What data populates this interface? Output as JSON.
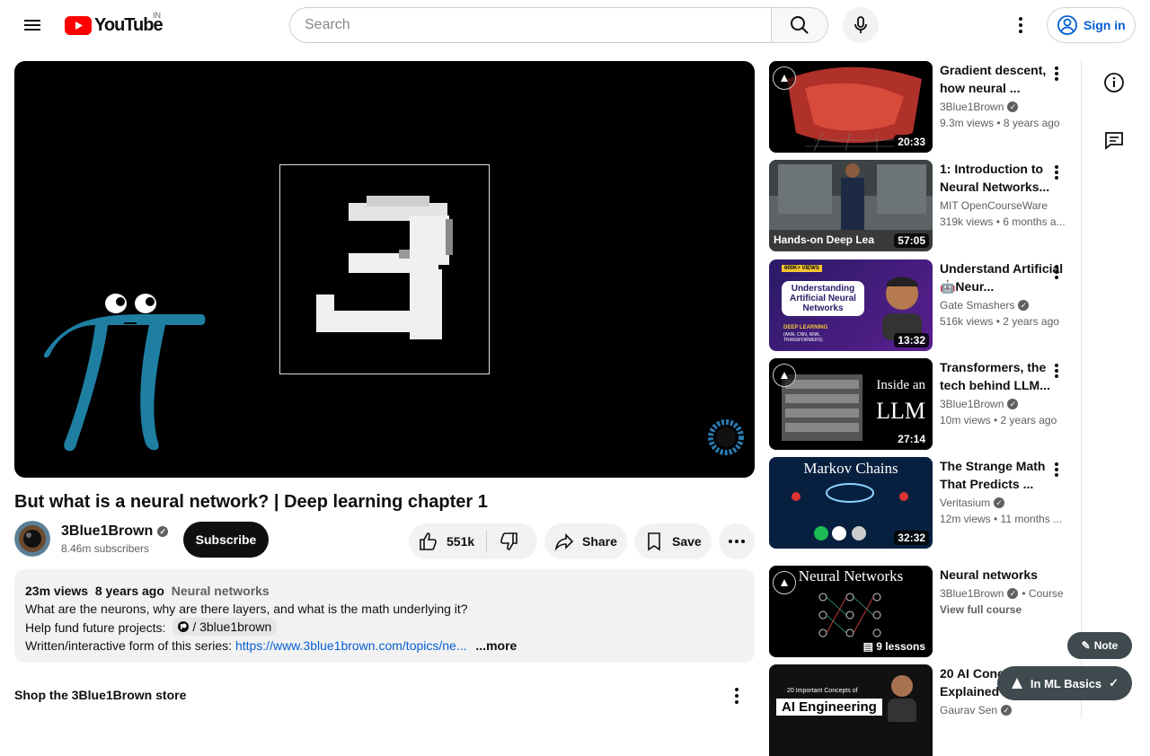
{
  "header": {
    "logo_text": "YouTube",
    "region": "IN",
    "search_placeholder": "Search",
    "signin_label": "Sign in"
  },
  "video": {
    "title": "But what is a neural network? | Deep learning chapter 1",
    "channel_name": "3Blue1Brown",
    "subscribers": "8.46m subscribers",
    "subscribe_label": "Subscribe",
    "likes": "551k",
    "share_label": "Share",
    "save_label": "Save"
  },
  "description": {
    "views": "23m views",
    "age": "8 years ago",
    "tag": "Neural networks",
    "line1": "What are the neurons, why are there layers, and what is the math underlying it?",
    "line2_prefix": "Help fund future projects:",
    "fund_handle": "/ 3blue1brown",
    "line3_prefix": "Written/interactive form of this series:",
    "line3_link": "https://www.3blue1brown.com/topics/ne...",
    "more_label": "...more"
  },
  "store": {
    "title": "Shop the 3Blue1Brown store"
  },
  "recommendations": [
    {
      "title": "Gradient descent, how neural ...",
      "channel": "3Blue1Brown",
      "verified": true,
      "meta": "9.3m views • 8 years ago",
      "duration": "20:33"
    },
    {
      "title": "1: Introduction to Neural Networks...",
      "channel": "MIT OpenCourseWare",
      "verified": false,
      "meta": "319k views • 6 months a...",
      "duration": "57:05",
      "thumb_text": "Hands-on Deep Lea"
    },
    {
      "title": "Understand Artificial 🤖Neur...",
      "channel": "Gate Smashers",
      "verified": true,
      "meta": "516k views • 2 years ago",
      "duration": "13:32",
      "thumb_badge": "600K+ VIEWS",
      "thumb_text": "Understanding Artificial Neural Networks",
      "thumb_sub": "DEEP LEARNING",
      "thumb_sub2": "(ANN, CNN, RNN, TRANSFORMERS)"
    },
    {
      "title": "Transformers, the tech behind LLM...",
      "channel": "3Blue1Brown",
      "verified": true,
      "meta": "10m views • 2 years ago",
      "duration": "27:14",
      "thumb_text": "Inside an",
      "thumb_big": "LLM"
    },
    {
      "title": "The Strange Math That Predicts ...",
      "channel": "Veritasium",
      "verified": true,
      "meta": "12m views • 11 months ...",
      "duration": "32:32",
      "thumb_text": "Markov Chains"
    },
    {
      "title": "Neural networks",
      "channel": "3Blue1Brown",
      "verified": true,
      "channel_suffix": "• Course",
      "meta": "View full course",
      "duration": "9 lessons",
      "thumb_text": "Neural Networks"
    },
    {
      "title": "20 AI Conc... Explained i...",
      "channel": "Gaurav Sen",
      "verified": true,
      "meta": "",
      "duration": "",
      "thumb_text": "20 Important Concepts of",
      "thumb_big": "AI Engineering"
    }
  ],
  "floating": {
    "note_label": "Note",
    "inml_label": "In ML Basics"
  },
  "colors": {
    "brand_red": "#ff0000",
    "link_blue": "#065fd4",
    "pi_blue": "#1f7fa3"
  }
}
